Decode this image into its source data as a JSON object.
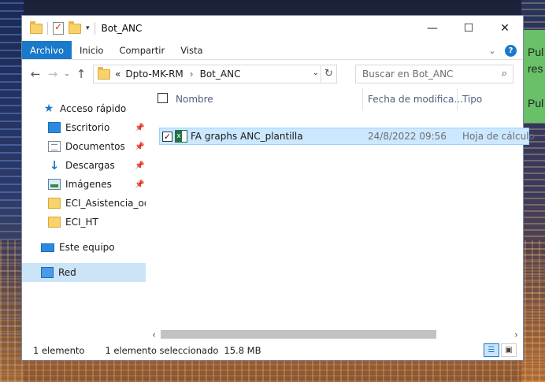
{
  "toast": {
    "line1": "Pul",
    "line2": "res",
    "line3": "Pul"
  },
  "window": {
    "title": "Bot_ANC",
    "controls": {
      "minimize": "—",
      "maximize": "☐",
      "close": "✕"
    }
  },
  "ribbon": {
    "tabs": [
      "Archivo",
      "Inicio",
      "Compartir",
      "Vista"
    ],
    "expand_glyph": "⌄",
    "help": "?"
  },
  "address": {
    "back": "←",
    "forward": "→",
    "recent": "⌄",
    "up": "↑",
    "overflow": "«",
    "crumbs": [
      "Dpto-MK-RM",
      "Bot_ANC"
    ],
    "separator": "›",
    "refresh": "↻",
    "dropdown": "⌄"
  },
  "search": {
    "placeholder": "Buscar en Bot_ANC",
    "icon": "⌕"
  },
  "navpane": {
    "quick_access": "Acceso rápido",
    "items": [
      {
        "label": "Escritorio",
        "icon": "desktop-icon",
        "pinned": true
      },
      {
        "label": "Documentos",
        "icon": "documents-icon",
        "pinned": true
      },
      {
        "label": "Descargas",
        "icon": "downloads-icon",
        "pinned": true
      },
      {
        "label": "Imágenes",
        "icon": "pictures-icon",
        "pinned": true
      },
      {
        "label": "ECI_Asistencia_odoo",
        "icon": "folder-icon",
        "pinned": false
      },
      {
        "label": "ECI_HT",
        "icon": "folder-icon",
        "pinned": false
      }
    ],
    "this_pc": "Este equipo",
    "network": "Red",
    "pin_glyph": "📌"
  },
  "columns": {
    "name": "Nombre",
    "date": "Fecha de modifica...",
    "type": "Tipo"
  },
  "files": [
    {
      "name": "FA graphs ANC_plantilla",
      "date": "24/8/2022 09:56",
      "type": "Hoja de cálculo",
      "selected": true,
      "check": "✓"
    }
  ],
  "scroll": {
    "left": "‹",
    "right": "›"
  },
  "status": {
    "count": "1 elemento",
    "selected": "1 elemento seleccionado",
    "size": "15.8 MB"
  },
  "colors": {
    "accent": "#1979ca",
    "selection": "#cce8ff",
    "toast": "#6abf69"
  }
}
